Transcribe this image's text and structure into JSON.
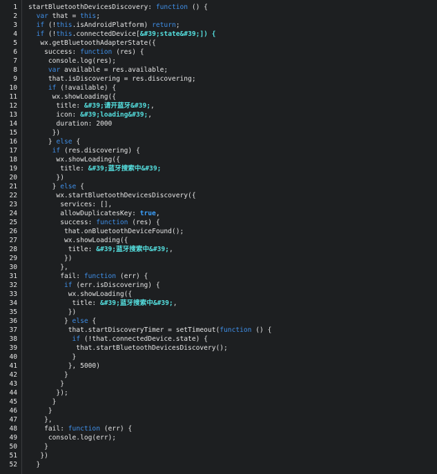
{
  "editor": {
    "lines": [
      {
        "n": "1",
        "parts": [
          {
            "t": "startBluetoothDevicesDiscovery: ",
            "c": ""
          },
          {
            "t": "function",
            "c": "kw"
          },
          {
            "t": " () {",
            "c": ""
          }
        ]
      },
      {
        "n": "2",
        "parts": [
          {
            "t": "  ",
            "c": ""
          },
          {
            "t": "var",
            "c": "kw"
          },
          {
            "t": " that = ",
            "c": ""
          },
          {
            "t": "this",
            "c": "kw"
          },
          {
            "t": ";",
            "c": ""
          }
        ]
      },
      {
        "n": "3",
        "parts": [
          {
            "t": "  ",
            "c": ""
          },
          {
            "t": "if",
            "c": "kw"
          },
          {
            "t": " (!",
            "c": ""
          },
          {
            "t": "this",
            "c": "kw"
          },
          {
            "t": ".isAndroidPlatform) ",
            "c": ""
          },
          {
            "t": "return",
            "c": "kw"
          },
          {
            "t": ";",
            "c": ""
          }
        ]
      },
      {
        "n": "4",
        "parts": [
          {
            "t": "  ",
            "c": ""
          },
          {
            "t": "if",
            "c": "kw"
          },
          {
            "t": " (!",
            "c": ""
          },
          {
            "t": "this",
            "c": "kw"
          },
          {
            "t": ".connectedDevice[",
            "c": ""
          },
          {
            "t": "&#39;state&#39;",
            "c": "str"
          },
          {
            "t": "]) {",
            "c": "str"
          }
        ]
      },
      {
        "n": "5",
        "parts": [
          {
            "t": "   wx.getBluetoothAdapterState({",
            "c": ""
          }
        ]
      },
      {
        "n": "6",
        "parts": [
          {
            "t": "    success: ",
            "c": ""
          },
          {
            "t": "function",
            "c": "kw"
          },
          {
            "t": " (res) {",
            "c": ""
          }
        ]
      },
      {
        "n": "7",
        "parts": [
          {
            "t": "     console.log(res);",
            "c": ""
          }
        ]
      },
      {
        "n": "8",
        "parts": [
          {
            "t": "     ",
            "c": ""
          },
          {
            "t": "var",
            "c": "kw"
          },
          {
            "t": " available = res.available;",
            "c": ""
          }
        ]
      },
      {
        "n": "9",
        "parts": [
          {
            "t": "     that.isDiscovering = res.discovering;",
            "c": ""
          }
        ]
      },
      {
        "n": "10",
        "parts": [
          {
            "t": "     ",
            "c": ""
          },
          {
            "t": "if",
            "c": "kw"
          },
          {
            "t": " (!available) {",
            "c": ""
          }
        ]
      },
      {
        "n": "11",
        "parts": [
          {
            "t": "      wx.showLoading({",
            "c": ""
          }
        ]
      },
      {
        "n": "12",
        "parts": [
          {
            "t": "       title: ",
            "c": ""
          },
          {
            "t": "&#39;请开蓝牙&#39;",
            "c": "str"
          },
          {
            "t": ",",
            "c": ""
          }
        ]
      },
      {
        "n": "13",
        "parts": [
          {
            "t": "       icon: ",
            "c": ""
          },
          {
            "t": "&#39;loading&#39;",
            "c": "str"
          },
          {
            "t": ",",
            "c": ""
          }
        ]
      },
      {
        "n": "14",
        "parts": [
          {
            "t": "       duration: 2000",
            "c": ""
          }
        ]
      },
      {
        "n": "15",
        "parts": [
          {
            "t": "      })",
            "c": ""
          }
        ]
      },
      {
        "n": "16",
        "parts": [
          {
            "t": "     } ",
            "c": ""
          },
          {
            "t": "else",
            "c": "kw"
          },
          {
            "t": " {",
            "c": ""
          }
        ]
      },
      {
        "n": "17",
        "parts": [
          {
            "t": "      ",
            "c": ""
          },
          {
            "t": "if",
            "c": "kw"
          },
          {
            "t": " (res.discovering) {",
            "c": ""
          }
        ]
      },
      {
        "n": "18",
        "parts": [
          {
            "t": "       wx.showLoading({",
            "c": ""
          }
        ]
      },
      {
        "n": "19",
        "parts": [
          {
            "t": "        title: ",
            "c": ""
          },
          {
            "t": "&#39;蓝牙搜索中&#39;",
            "c": "str"
          }
        ]
      },
      {
        "n": "20",
        "parts": [
          {
            "t": "       })",
            "c": ""
          }
        ]
      },
      {
        "n": "21",
        "parts": [
          {
            "t": "      } ",
            "c": ""
          },
          {
            "t": "else",
            "c": "kw"
          },
          {
            "t": " {",
            "c": ""
          }
        ]
      },
      {
        "n": "22",
        "parts": [
          {
            "t": "       wx.startBluetoothDevicesDiscovery({",
            "c": ""
          }
        ]
      },
      {
        "n": "23",
        "parts": [
          {
            "t": "        services: [],",
            "c": ""
          }
        ]
      },
      {
        "n": "24",
        "parts": [
          {
            "t": "        allowDuplicatesKey: ",
            "c": ""
          },
          {
            "t": "true",
            "c": "bkw"
          },
          {
            "t": ",",
            "c": ""
          }
        ]
      },
      {
        "n": "25",
        "parts": [
          {
            "t": "        success: ",
            "c": ""
          },
          {
            "t": "function",
            "c": "kw"
          },
          {
            "t": " (res) {",
            "c": ""
          }
        ]
      },
      {
        "n": "26",
        "parts": [
          {
            "t": "         that.onBluetoothDeviceFound();",
            "c": ""
          }
        ]
      },
      {
        "n": "27",
        "parts": [
          {
            "t": "         wx.showLoading({",
            "c": ""
          }
        ]
      },
      {
        "n": "28",
        "parts": [
          {
            "t": "          title: ",
            "c": ""
          },
          {
            "t": "&#39;蓝牙搜索中&#39;",
            "c": "str"
          },
          {
            "t": ",",
            "c": ""
          }
        ]
      },
      {
        "n": "29",
        "parts": [
          {
            "t": "         })",
            "c": ""
          }
        ]
      },
      {
        "n": "30",
        "parts": [
          {
            "t": "        },",
            "c": ""
          }
        ]
      },
      {
        "n": "31",
        "parts": [
          {
            "t": "        fail: ",
            "c": ""
          },
          {
            "t": "function",
            "c": "kw"
          },
          {
            "t": " (err) {",
            "c": ""
          }
        ]
      },
      {
        "n": "32",
        "parts": [
          {
            "t": "         ",
            "c": ""
          },
          {
            "t": "if",
            "c": "kw"
          },
          {
            "t": " (err.isDiscovering) {",
            "c": ""
          }
        ]
      },
      {
        "n": "33",
        "parts": [
          {
            "t": "          wx.showLoading({",
            "c": ""
          }
        ]
      },
      {
        "n": "34",
        "parts": [
          {
            "t": "           title: ",
            "c": ""
          },
          {
            "t": "&#39;蓝牙搜索中&#39;",
            "c": "str"
          },
          {
            "t": ",",
            "c": ""
          }
        ]
      },
      {
        "n": "35",
        "parts": [
          {
            "t": "          })",
            "c": ""
          }
        ]
      },
      {
        "n": "36",
        "parts": [
          {
            "t": "         } ",
            "c": ""
          },
          {
            "t": "else",
            "c": "kw"
          },
          {
            "t": " {",
            "c": ""
          }
        ]
      },
      {
        "n": "37",
        "parts": [
          {
            "t": "          that.startDiscoveryTimer = setTimeout(",
            "c": ""
          },
          {
            "t": "function",
            "c": "kw"
          },
          {
            "t": " () {",
            "c": ""
          }
        ]
      },
      {
        "n": "38",
        "parts": [
          {
            "t": "           ",
            "c": ""
          },
          {
            "t": "if",
            "c": "kw"
          },
          {
            "t": " (!that.connectedDevice.state) {",
            "c": ""
          }
        ]
      },
      {
        "n": "39",
        "parts": [
          {
            "t": "            that.startBluetoothDevicesDiscovery();",
            "c": ""
          }
        ]
      },
      {
        "n": "40",
        "parts": [
          {
            "t": "           }",
            "c": ""
          }
        ]
      },
      {
        "n": "41",
        "parts": [
          {
            "t": "          }, 5000)",
            "c": ""
          }
        ]
      },
      {
        "n": "42",
        "parts": [
          {
            "t": "         }",
            "c": ""
          }
        ]
      },
      {
        "n": "43",
        "parts": [
          {
            "t": "        }",
            "c": ""
          }
        ]
      },
      {
        "n": "44",
        "parts": [
          {
            "t": "       });",
            "c": ""
          }
        ]
      },
      {
        "n": "45",
        "parts": [
          {
            "t": "      }",
            "c": ""
          }
        ]
      },
      {
        "n": "46",
        "parts": [
          {
            "t": "     }",
            "c": ""
          }
        ]
      },
      {
        "n": "47",
        "parts": [
          {
            "t": "    },",
            "c": ""
          }
        ]
      },
      {
        "n": "48",
        "parts": [
          {
            "t": "    fail: ",
            "c": ""
          },
          {
            "t": "function",
            "c": "kw"
          },
          {
            "t": " (err) {",
            "c": ""
          }
        ]
      },
      {
        "n": "49",
        "parts": [
          {
            "t": "     console.log(err);",
            "c": ""
          }
        ]
      },
      {
        "n": "50",
        "parts": [
          {
            "t": "    }",
            "c": ""
          }
        ]
      },
      {
        "n": "51",
        "parts": [
          {
            "t": "   })",
            "c": ""
          }
        ]
      },
      {
        "n": "52",
        "parts": [
          {
            "t": "  }",
            "c": ""
          }
        ]
      }
    ],
    "colors": {
      "background": "#1d1f21",
      "text": "#e6e6e6",
      "keyword": "#3f8fe8",
      "string": "#55e0e0"
    }
  }
}
